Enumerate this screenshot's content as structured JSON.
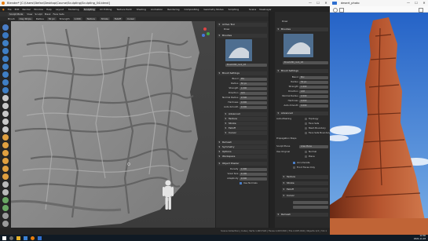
{
  "window": {
    "title": "Blender* [C:\\Users\\Stefan\\Desktop\\Course\\Sculpting\\Sculpting_04.blend]",
    "min": "—",
    "max": "☐",
    "close": "✕"
  },
  "menu": {
    "items": [
      "File",
      "Edit",
      "Render",
      "Window",
      "Help"
    ],
    "workspaces": [
      "Layout",
      "Modeling",
      "Sculpting",
      "UV Editing",
      "Texture Paint",
      "Shading",
      "Animation",
      "Rendering",
      "Compositing",
      "Geometry Nodes",
      "Scripting"
    ],
    "active_workspace": "Sculpting",
    "scene": "Scene",
    "view_layer": "ViewLayer"
  },
  "header": {
    "mode": "Sculpt Mode",
    "menus": [
      "View",
      "Sculpt",
      "Mask",
      "Face Sets"
    ],
    "brush_label": "Brush",
    "radius_label": "Radius",
    "strength_label": "Strength",
    "brush_name": "Clay Strips",
    "texture_label": "Texture",
    "stroke_label": "Stroke",
    "falloff_label": "Falloff",
    "cursor_label": "Cursor"
  },
  "npanel": {
    "active_tool_head": "Active Tool",
    "tool_name": "Draw",
    "brushes_head": "Brushes",
    "brush_file": "Brush.MD_rock_18",
    "brush_settings_head": "Brush Settings",
    "rows": [
      {
        "label": "Blend",
        "value": "Mix"
      },
      {
        "label": "Radius",
        "value": "50 px"
      },
      {
        "label": "Strength",
        "value": "1.000"
      },
      {
        "label": "Direction",
        "value": "Add"
      },
      {
        "label": "Normal Radius",
        "value": "0.500"
      },
      {
        "label": "Hardness",
        "value": "0.000"
      },
      {
        "label": "Auto-Smooth",
        "value": "0.000"
      }
    ],
    "sections": [
      "Advanced",
      "Texture",
      "Stroke",
      "Falloff",
      "Cursor"
    ],
    "sections2": [
      "Remesh",
      "Symmetry",
      "Options",
      "Workspace"
    ],
    "object_head": "Object Shader",
    "obj_rows": [
      {
        "label": "Density",
        "value": "1.000"
      },
      {
        "label": "Voxel Size",
        "value": "0.100"
      },
      {
        "label": "Adaptivity",
        "value": "0.000"
      }
    ],
    "use_normals": "Use Normals"
  },
  "props": {
    "tool_name": "Draw",
    "brushes_head": "Brushes",
    "brush_file": "Brush.MD_rock_18",
    "brush_settings_head": "Brush Settings",
    "rows": [
      {
        "label": "Blend",
        "value": "Mix"
      },
      {
        "label": "Radius",
        "value": "50 px"
      },
      {
        "label": "Strength",
        "value": "1.000"
      },
      {
        "label": "Direction",
        "value": "Add"
      },
      {
        "label": "Normal Radius",
        "value": "0.500"
      },
      {
        "label": "Hardness",
        "value": "0.000"
      },
      {
        "label": "Auto-Smooth",
        "value": "0.000"
      }
    ],
    "advanced_head": "Advanced",
    "auto_masking": "Auto-Masking",
    "masks": [
      "Topology",
      "Face Sets",
      "Mesh Boundary",
      "Face Sets Boundary"
    ],
    "propagation": "Propagation Steps",
    "sculpt_plane": "Sculpt Plane",
    "sculpt_plane_val": "Area Plane",
    "use_original": "Use Original",
    "orig_checks": [
      "Normal",
      "Plane"
    ],
    "accumulate": "Accumulate",
    "front_faces": "Front Faces Only",
    "sections": [
      "Texture",
      "Stroke",
      "Falloff",
      "Cursor"
    ],
    "remesh": "Remesh"
  },
  "status": "Scene Collection | Cube | Verts 1,003,524 | Faces 1,003,520 | Tris 2,007,040 | Objects 1/2 | 3.0.1",
  "photo": {
    "title": "desert_photo",
    "min": "—",
    "max": "☐",
    "close": "✕"
  },
  "taskbar": {
    "time": "12:30",
    "date": "2021-11-03"
  },
  "colors": {
    "accent": "#4a7ec8",
    "blender_orange": "#e87d0d",
    "sky": "#2f6fd0",
    "rock": "#a8492a"
  }
}
